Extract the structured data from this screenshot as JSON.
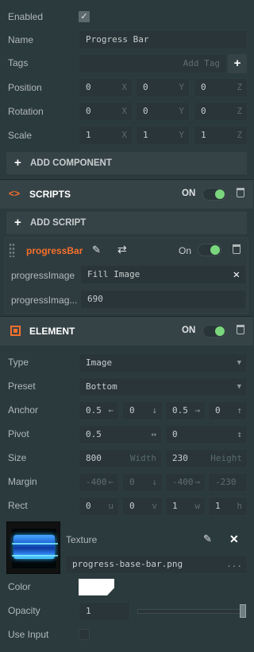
{
  "entity": {
    "enabled_label": "Enabled",
    "enabled": true,
    "name_label": "Name",
    "name_value": "Progress Bar",
    "tags_label": "Tags",
    "tags_placeholder": "Add Tag",
    "position_label": "Position",
    "position": [
      "0",
      "0",
      "0"
    ],
    "rotation_label": "Rotation",
    "rotation": [
      "0",
      "0",
      "0"
    ],
    "scale_label": "Scale",
    "scale": [
      "1",
      "1",
      "1"
    ],
    "axes": [
      "X",
      "Y",
      "Z"
    ],
    "add_component_label": "ADD COMPONENT"
  },
  "scripts": {
    "title": "SCRIPTS",
    "on_label": "ON",
    "add_script_label": "ADD SCRIPT",
    "script_name": "progressBar",
    "script_on_label": "On",
    "attributes": [
      {
        "label": "progressImage",
        "value": "Fill Image"
      },
      {
        "label": "progressImag...",
        "value": "690"
      }
    ]
  },
  "element": {
    "title": "ELEMENT",
    "on_label": "ON",
    "type_label": "Type",
    "type_value": "Image",
    "preset_label": "Preset",
    "preset_value": "Bottom",
    "anchor_label": "Anchor",
    "anchor": [
      "0.5",
      "0",
      "0.5",
      "0"
    ],
    "pivot_label": "Pivot",
    "pivot": [
      "0.5",
      "0"
    ],
    "size_label": "Size",
    "width_value": "800",
    "width_suffix": "Width",
    "height_value": "230",
    "height_suffix": "Height",
    "margin_label": "Margin",
    "margin": [
      "-400",
      "0",
      "-400",
      "-230"
    ],
    "rect_label": "Rect",
    "rect": [
      "0",
      "0",
      "1",
      "1"
    ],
    "rect_axes": [
      "u",
      "v",
      "w",
      "h"
    ],
    "texture_label": "Texture",
    "texture_value": "progress-base-bar.png",
    "texture_more": "...",
    "color_label": "Color",
    "color_value": "#ffffff",
    "opacity_label": "Opacity",
    "opacity_value": "1",
    "opacity_fraction": 1.0,
    "use_input_label": "Use Input",
    "use_input": false
  },
  "colors": {
    "panel_bg": "#2a3a3d",
    "accent_orange": "#f6702c",
    "toggle_on": "#7bd77d"
  }
}
